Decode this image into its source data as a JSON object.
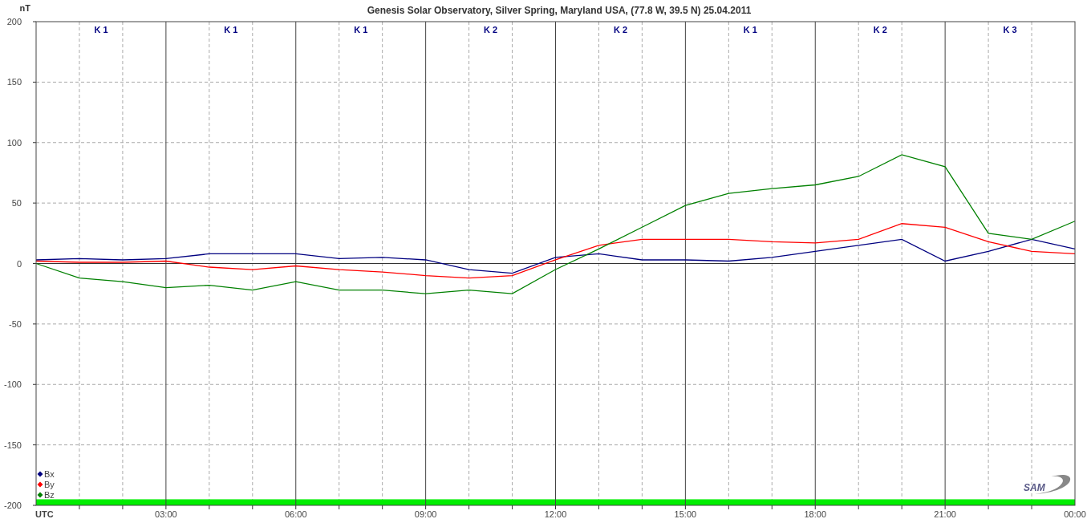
{
  "title": "Genesis Solar Observatory, Silver Spring, Maryland USA, (77.8 W, 39.5 N)  25.04.2011",
  "k_indices": [
    "K 1",
    "K 1",
    "K 1",
    "K 2",
    "K 2",
    "K 1",
    "K 2",
    "K 3"
  ],
  "logo_text": "SAM",
  "chart_data": {
    "type": "line",
    "ylabel": "nT",
    "x": [
      0,
      1,
      2,
      3,
      4,
      5,
      6,
      7,
      8,
      9,
      10,
      11,
      12,
      13,
      14,
      15,
      16,
      17,
      18,
      19,
      20,
      21,
      22,
      23,
      24
    ],
    "xlim": [
      0,
      24
    ],
    "ylim": [
      -200,
      200
    ],
    "grid": true,
    "legend": "lower left",
    "bands": [
      {
        "axis": "y",
        "from": -200,
        "to": -195,
        "color": "#00ee00"
      }
    ],
    "xticks": [
      {
        "value": 0,
        "label": "UTC"
      },
      {
        "value": 3,
        "label": "03:00"
      },
      {
        "value": 6,
        "label": "06:00"
      },
      {
        "value": 9,
        "label": "09:00"
      },
      {
        "value": 12,
        "label": "12:00"
      },
      {
        "value": 15,
        "label": "15:00"
      },
      {
        "value": 18,
        "label": "18:00"
      },
      {
        "value": 21,
        "label": "21:00"
      },
      {
        "value": 24,
        "label": "00:00"
      }
    ],
    "yticks": [
      200,
      150,
      100,
      50,
      0,
      -50,
      -100,
      -150,
      -200
    ],
    "series": [
      {
        "name": "Bx",
        "color": "#000080",
        "values": [
          3,
          4,
          3,
          4,
          8,
          8,
          8,
          4,
          5,
          3,
          -5,
          -8,
          5,
          8,
          3,
          3,
          2,
          5,
          10,
          15,
          20,
          2,
          10,
          20,
          12
        ]
      },
      {
        "name": "By",
        "color": "#ff0000",
        "values": [
          2,
          1,
          1,
          2,
          -3,
          -5,
          -2,
          -5,
          -7,
          -10,
          -12,
          -10,
          3,
          15,
          20,
          20,
          20,
          18,
          17,
          20,
          33,
          30,
          18,
          10,
          8
        ]
      },
      {
        "name": "Bz",
        "color": "#008000",
        "values": [
          0,
          -12,
          -15,
          -20,
          -18,
          -22,
          -15,
          -22,
          -22,
          -25,
          -22,
          -25,
          -5,
          12,
          30,
          48,
          58,
          62,
          65,
          72,
          90,
          80,
          25,
          20,
          35
        ]
      }
    ]
  }
}
